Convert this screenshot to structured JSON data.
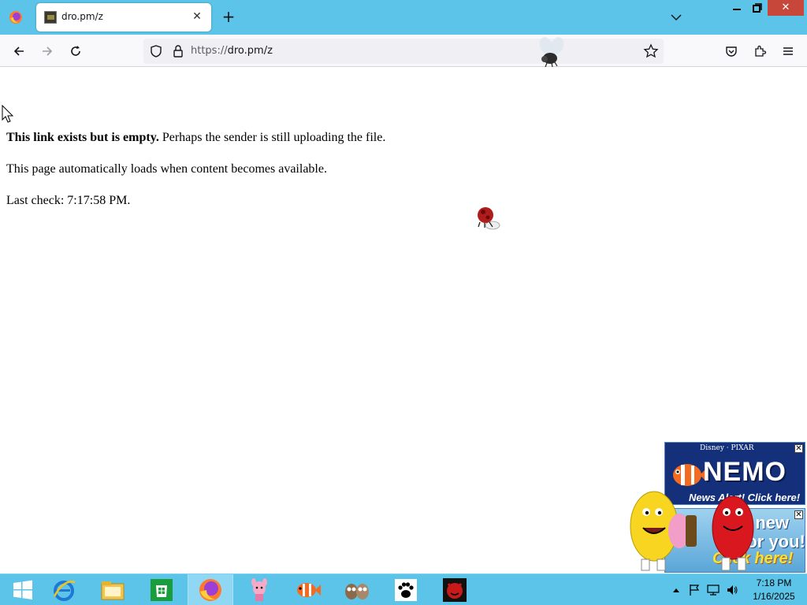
{
  "browser": {
    "tab": {
      "title": "dro.pm/z"
    },
    "url": {
      "scheme": "https://",
      "host": "dro.pm/z"
    }
  },
  "page": {
    "line1_bold": "This link exists but is empty.",
    "line1_rest": " Perhaps the sender is still uploading the file.",
    "line2": "This page automatically loads when content becomes available.",
    "line3": "Last check: 7:17:58 PM."
  },
  "ads": {
    "nemo": {
      "brand": "Disney · PIXAR",
      "headline": "NEMO",
      "sub": "News Alert! Click here!"
    },
    "mm": {
      "text": "a new for you!",
      "click": "Click here!"
    }
  },
  "taskbar": {
    "items": [
      "start-icon",
      "internet-explorer-icon",
      "file-explorer-icon",
      "store-icon",
      "firefox-icon",
      "piglet-icon",
      "fish-icon",
      "owls-icon",
      "paw-icon",
      "red-devil-icon"
    ],
    "clock": {
      "time": "7:18 PM",
      "date": "1/16/2025"
    }
  },
  "colors": {
    "titlebar": "#5bc4e8",
    "close_button": "#c7483a",
    "taskbar": "#5bc4e8"
  }
}
